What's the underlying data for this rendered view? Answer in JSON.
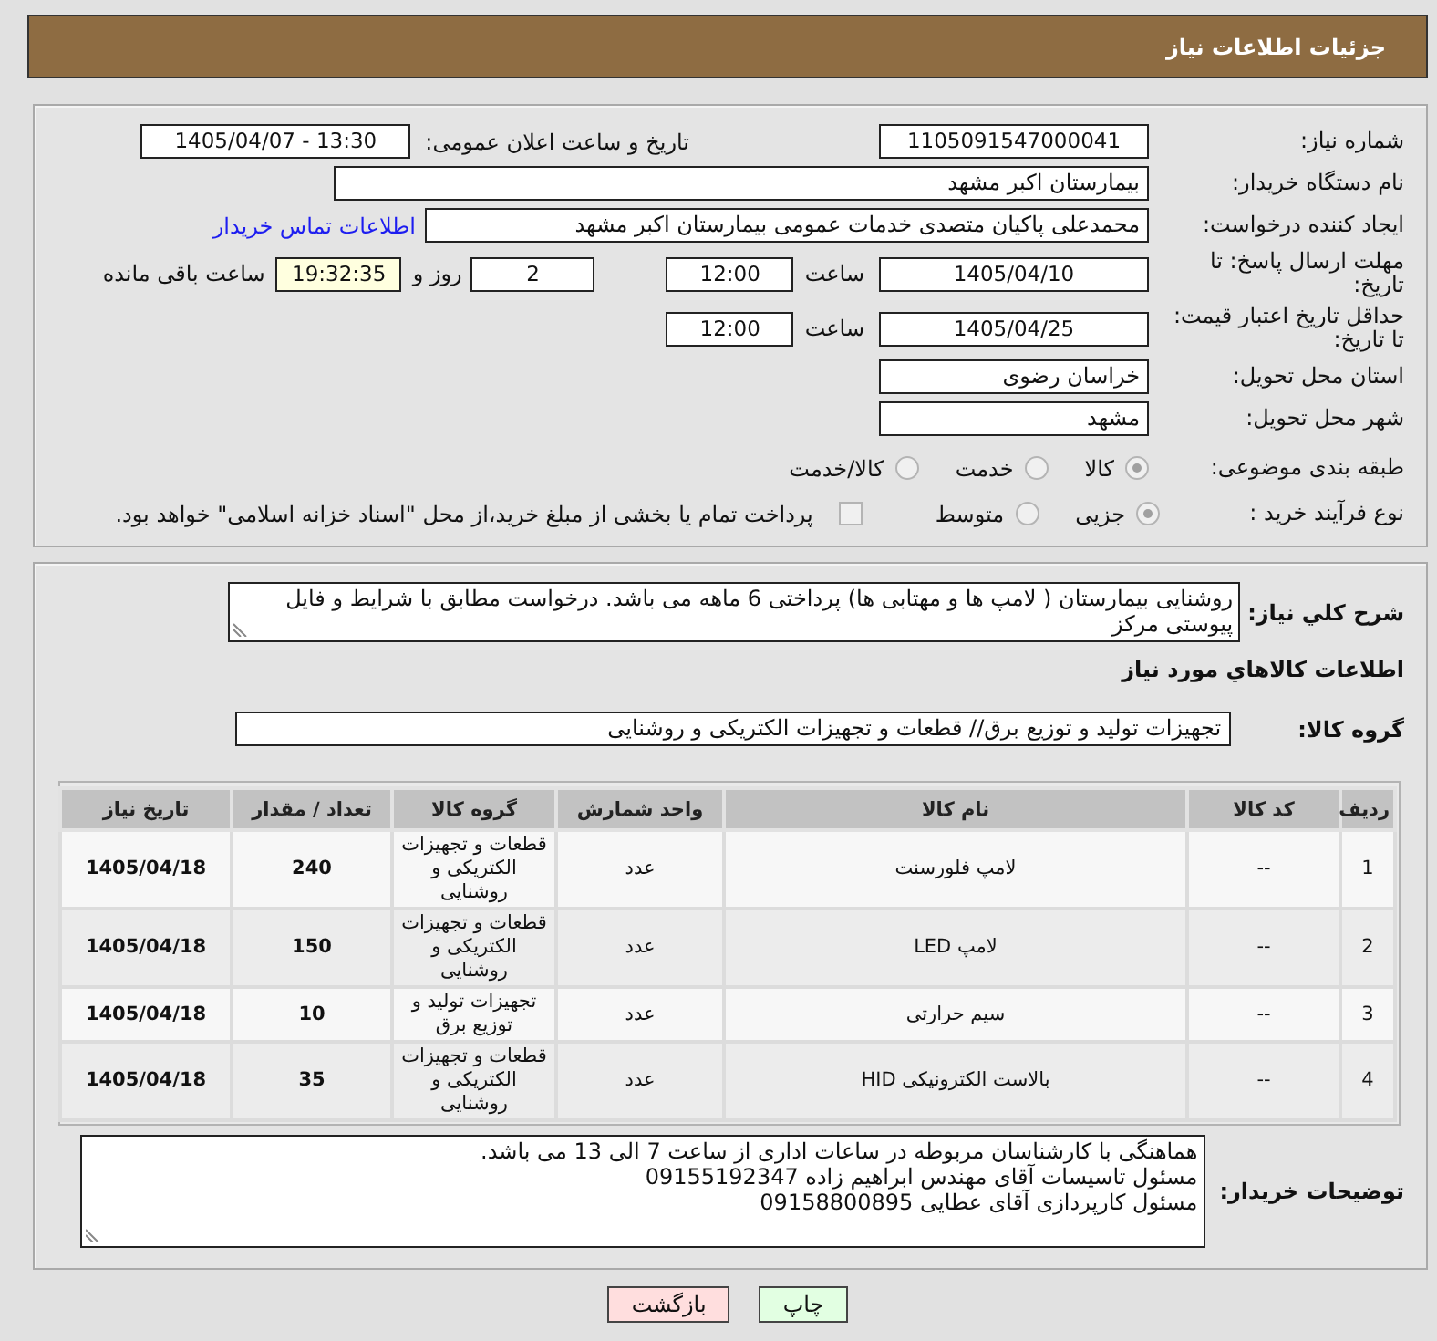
{
  "header": {
    "title": "جزئیات اطلاعات نیاز"
  },
  "need_details": {
    "need_number": {
      "label": "شماره نیاز:",
      "value": "1105091547000041"
    },
    "announcement": {
      "label": "تاریخ و ساعت اعلان عمومی:",
      "value": "1405/04/07 - 13:30"
    },
    "buyer_organization": {
      "label": "نام دستگاه خریدار:",
      "value": "بیمارستان اکبر مشهد"
    },
    "requester": {
      "label": "ایجاد کننده درخواست:",
      "value": "محمدعلی پاکیان متصدی خدمات عمومی بیمارستان اکبر مشهد",
      "contact_link": "اطلاعات تماس خریدار"
    },
    "response_deadline": {
      "label": "مهلت ارسال پاسخ: تا تاریخ:",
      "date": "1405/04/10",
      "time_label": "ساعت",
      "time": "12:00",
      "days": "2",
      "days_label": "روز و",
      "remaining_time": "19:32:35",
      "remaining_label": "ساعت باقی مانده"
    },
    "price_validity": {
      "label": "حداقل تاریخ اعتبار قیمت: تا تاریخ:",
      "date": "1405/04/25",
      "time_label": "ساعت",
      "time": "12:00"
    },
    "delivery_province": {
      "label": "استان محل تحویل:",
      "value": "خراسان رضوی"
    },
    "delivery_city": {
      "label": "شهر محل تحویل:",
      "value": "مشهد"
    },
    "subject_category": {
      "label": "طبقه بندی موضوعی:",
      "options": [
        {
          "label": "کالا",
          "selected": true,
          "disabled": true
        },
        {
          "label": "خدمت",
          "selected": false,
          "disabled": true
        },
        {
          "label": "کالا/خدمت",
          "selected": false,
          "disabled": true
        }
      ]
    },
    "purchase_type": {
      "label": "نوع فرآیند خرید :",
      "options": [
        {
          "label": "جزیی",
          "selected": true,
          "disabled": true
        },
        {
          "label": "متوسط",
          "selected": false,
          "disabled": true
        }
      ],
      "treasury_option": {
        "label": "پرداخت تمام یا بخشی از مبلغ خرید،از محل \"اسناد خزانه اسلامی\" خواهد بود.",
        "checked": false,
        "disabled": true
      }
    }
  },
  "requirements": {
    "description": {
      "label": "شرح کلي نیاز:",
      "value": "روشنایی بیمارستان ( لامپ ها و مهتابی ها) پرداختی 6 ماهه می باشد. درخواست مطابق با شرایط و فایل پیوستی مرکز"
    },
    "goods_heading": "اطلاعات کالاهاي مورد نیاز",
    "goods_group": {
      "label": "گروه کالا:",
      "value": "تجهیزات تولید و توزیع برق// قطعات و تجهیزات الکتریکی و روشنایی"
    },
    "goods_table": {
      "columns": [
        "ردیف",
        "کد کالا",
        "نام کالا",
        "واحد شمارش",
        "گروه کالا",
        "تعداد / مقدار",
        "تاریخ نیاز"
      ],
      "rows": [
        [
          "1",
          "--",
          "لامپ فلورسنت",
          "عدد",
          "قطعات و تجهیزات الکتریکی و روشنایی",
          "240",
          "1405/04/18"
        ],
        [
          "2",
          "--",
          "لامپ LED",
          "عدد",
          "قطعات و تجهیزات الکتریکی و روشنایی",
          "150",
          "1405/04/18"
        ],
        [
          "3",
          "--",
          "سیم حرارتی",
          "عدد",
          "تجهیزات تولید و توزیع برق",
          "10",
          "1405/04/18"
        ],
        [
          "4",
          "--",
          "بالاست الکترونیکی HID",
          "عدد",
          "قطعات و تجهیزات الکتریکی و روشنایی",
          "35",
          "1405/04/18"
        ]
      ]
    },
    "buyer_notes": {
      "label": "توضیحات خریدار:",
      "value": "هماهنگی با کارشناسان مربوطه در ساعات اداری از ساعت 7 الی 13 می باشد.\nمسئول تاسیسات آقای مهندس ابراهیم زاده 09155192347\nمسئول کارپردازی آقای عطایی 09158800895"
    }
  },
  "buttons": [
    {
      "kind": "print",
      "label": "چاپ"
    },
    {
      "kind": "back",
      "label": "بازگشت"
    }
  ]
}
